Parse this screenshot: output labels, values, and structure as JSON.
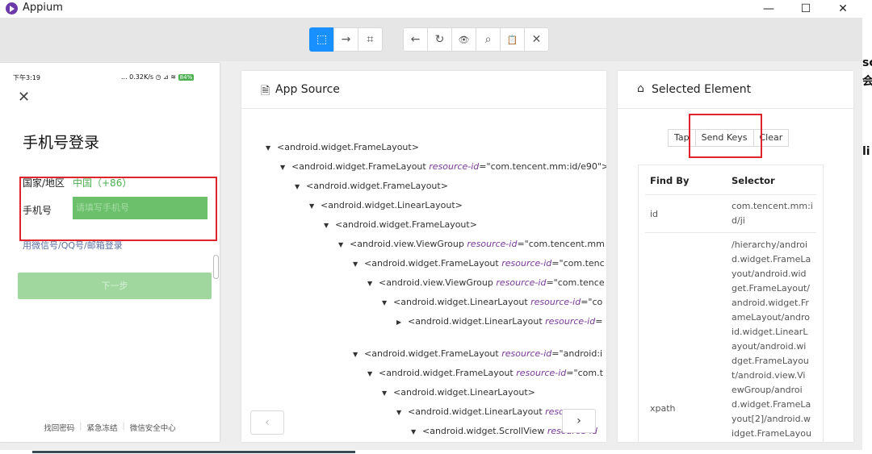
{
  "window": {
    "title": "Appium",
    "minimize": "—",
    "maximize": "☐",
    "close": "✕"
  },
  "toolbar": {
    "group1": [
      {
        "name": "select-elements",
        "icon": "⬚"
      },
      {
        "name": "swipe-by-coordinates",
        "icon": "→"
      },
      {
        "name": "tap-by-coordinates",
        "icon": "⌗"
      }
    ],
    "group2": [
      {
        "name": "back",
        "icon": "←"
      },
      {
        "name": "refresh-source",
        "icon": "↻"
      },
      {
        "name": "start-recording",
        "icon": "👁"
      },
      {
        "name": "search-element",
        "icon": "⌕"
      },
      {
        "name": "copy-xml",
        "icon": "📋"
      },
      {
        "name": "quit-session",
        "icon": "✕"
      }
    ]
  },
  "phone": {
    "time": "下午3:19",
    "status_right": "... 0.32K/s ◷ ⊿ ≋",
    "battery": "84%",
    "close": "✕",
    "title": "手机号登录",
    "region_label": "国家/地区",
    "region_value": "中国（+86）",
    "phone_label": "手机号",
    "phone_placeholder": "请填写手机号",
    "alt_login": "用微信号/QQ号/邮箱登录",
    "next": "下一步",
    "footer": [
      "找回密码",
      "紧急冻结",
      "微信安全中心"
    ]
  },
  "source_panel": {
    "title": "App Source",
    "nodes": [
      {
        "tag": "<android.widget.FrameLayout>",
        "attr": "",
        "val": "",
        "toggle": "▼"
      },
      {
        "tag": "<android.widget.FrameLayout ",
        "attr": "resource-id",
        "val": "=\"com.tencent.mm:id/e90\">",
        "toggle": "▼"
      },
      {
        "tag": "<android.widget.FrameLayout>",
        "attr": "",
        "val": "",
        "toggle": "▼"
      },
      {
        "tag": "<android.widget.LinearLayout>",
        "attr": "",
        "val": "",
        "toggle": "▼"
      },
      {
        "tag": "<android.widget.FrameLayout>",
        "attr": "",
        "val": "",
        "toggle": "▼"
      },
      {
        "tag": "<android.view.ViewGroup ",
        "attr": "resource-id",
        "val": "=\"com.tencent.mm",
        "toggle": "▼"
      },
      {
        "tag": "<android.widget.FrameLayout ",
        "attr": "resource-id",
        "val": "=\"com.tenc",
        "toggle": "▼"
      },
      {
        "tag": "<android.view.ViewGroup ",
        "attr": "resource-id",
        "val": "=\"com.tence",
        "toggle": "▼"
      },
      {
        "tag": "<android.widget.LinearLayout ",
        "attr": "resource-id",
        "val": "=\"co",
        "toggle": "▼"
      },
      {
        "tag": "<android.widget.LinearLayout ",
        "attr": "resource-id",
        "val": "=",
        "toggle": "▶"
      },
      {
        "tag": "<android.widget.FrameLayout ",
        "attr": "resource-id",
        "val": "=\"android:i",
        "toggle": "▼"
      },
      {
        "tag": "<android.widget.FrameLayout ",
        "attr": "resource-id",
        "val": "=\"com.t",
        "toggle": "▼"
      },
      {
        "tag": "<android.widget.LinearLayout>",
        "attr": "",
        "val": "",
        "toggle": "▼"
      },
      {
        "tag": "<android.widget.LinearLayout ",
        "attr": "resou",
        "val": "",
        "toggle": "▼"
      },
      {
        "tag": "<android.widget.ScrollView ",
        "attr": "resource-id",
        "val": "",
        "toggle": "▼"
      }
    ],
    "prev": "‹",
    "next": "›"
  },
  "selected_panel": {
    "title": "Selected Element",
    "actions": [
      "Tap",
      "Send Keys",
      "Clear"
    ],
    "table_headers": [
      "Find By",
      "Selector"
    ],
    "rows": [
      {
        "find_by": "id",
        "selector": "com.tencent.mm:i\nd/ji"
      },
      {
        "find_by": "xpath",
        "selector": "/hierarchy/androi\nd.widget.FrameLa\nyout/android.wid\nget.FrameLayout/\nandroid.widget.Fr\nameLayout/andro\nid.widget.LinearL\nayout/android.wi\ndget.FrameLayou\nt/android.view.Vi\newGroup/androi\nd.widget.FrameLa\nyout[2]/android.w\nidget.FrameLayou"
      }
    ]
  },
  "right_strip": [
    "sc",
    "会",
    "li"
  ]
}
